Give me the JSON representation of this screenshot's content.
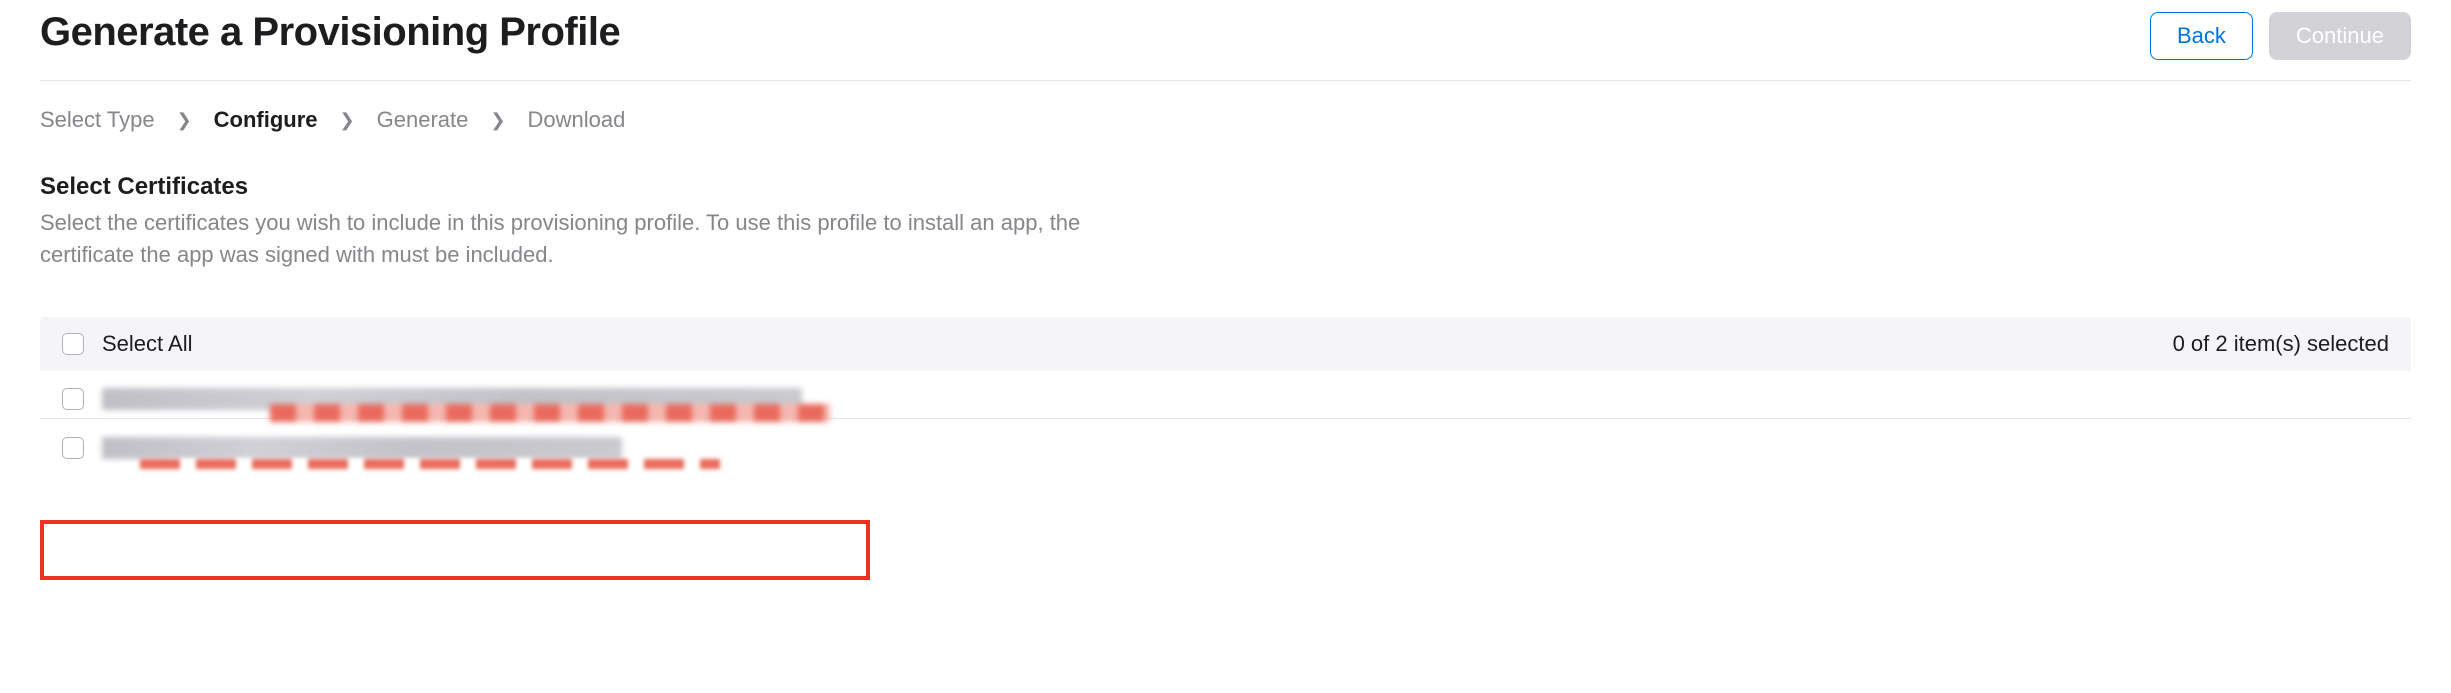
{
  "header": {
    "title": "Generate a Provisioning Profile",
    "buttons": {
      "back": "Back",
      "continue": "Continue"
    }
  },
  "breadcrumb": {
    "steps": [
      "Select Type",
      "Configure",
      "Generate",
      "Download"
    ],
    "active_index": 1
  },
  "section": {
    "title": "Select Certificates",
    "description": "Select the certificates you wish to include in this provisioning profile. To use this profile to install an app, the certificate the app was signed with must be included."
  },
  "list": {
    "select_all_label": "Select All",
    "selection_status": "0 of 2 item(s) selected",
    "items": [
      {
        "label_redacted": true
      },
      {
        "label_redacted": true
      }
    ]
  }
}
